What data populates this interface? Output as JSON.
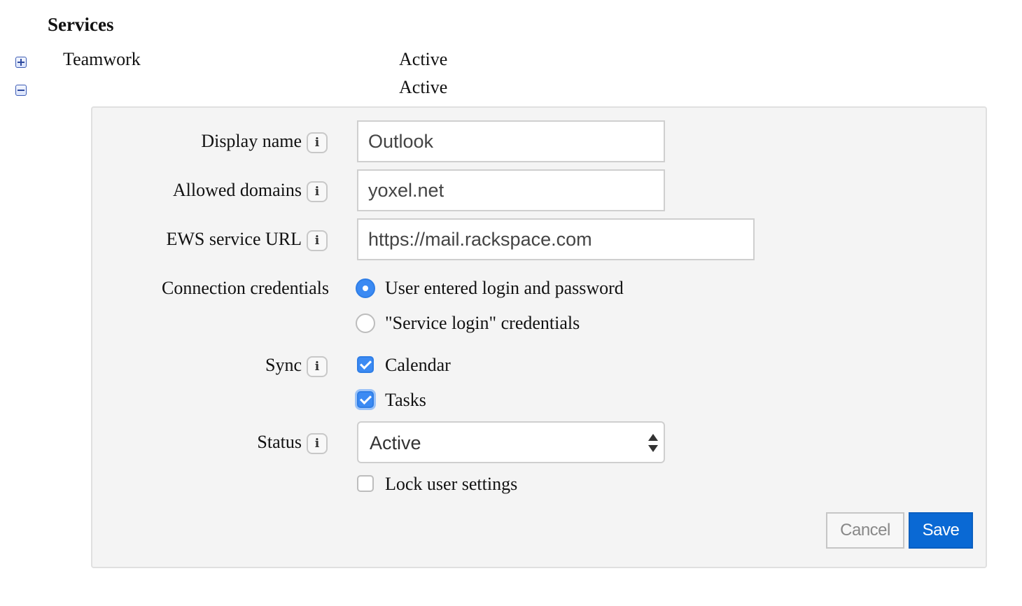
{
  "section": {
    "title": "Services"
  },
  "services": [
    {
      "name": "Teamwork",
      "status": "Active",
      "toggle_icon": "expand-plus-icon"
    },
    {
      "name": "",
      "status": "Active",
      "toggle_icon": "collapse-minus-icon"
    }
  ],
  "form": {
    "display_name": {
      "label": "Display name",
      "value": "Outlook",
      "info_icon": "i"
    },
    "allowed_domains": {
      "label": "Allowed domains",
      "value": "yoxel.net",
      "info_icon": "i"
    },
    "ews_url": {
      "label": "EWS service URL",
      "value": "https://mail.rackspace.com",
      "info_icon": "i"
    },
    "credentials": {
      "label": "Connection credentials",
      "options": [
        {
          "label": "User entered login and password",
          "selected": true
        },
        {
          "label": "\"Service login\" credentials",
          "selected": false
        }
      ]
    },
    "sync": {
      "label": "Sync",
      "info_icon": "i",
      "options": [
        {
          "label": "Calendar",
          "checked": true
        },
        {
          "label": "Tasks",
          "checked": true
        }
      ]
    },
    "status": {
      "label": "Status",
      "value": "Active",
      "info_icon": "i"
    },
    "lock": {
      "label": "Lock user settings",
      "checked": false
    },
    "buttons": {
      "cancel": "Cancel",
      "save": "Save"
    }
  },
  "colors": {
    "accent": "#3b8af3",
    "primary_button": "#0a69d4",
    "panel_bg": "#f4f4f4",
    "toggle_border": "#3c5bb4"
  }
}
